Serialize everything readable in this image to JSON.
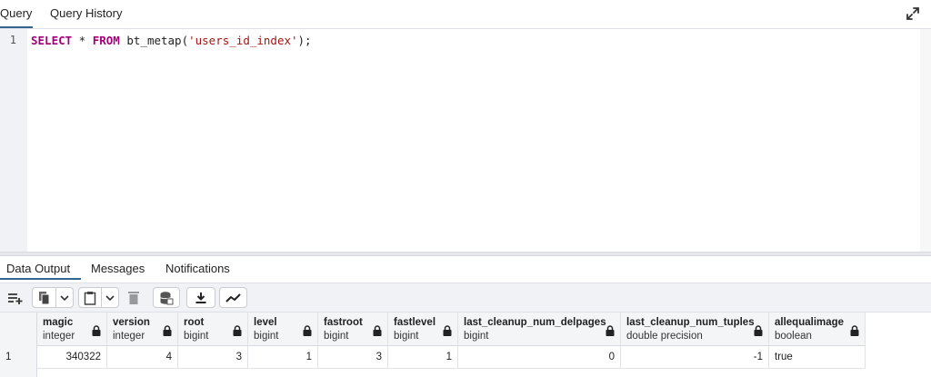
{
  "top_tabs": [
    "Query",
    "Query History"
  ],
  "editor": {
    "line_number": "1",
    "kw_select": "SELECT",
    "star": " * ",
    "kw_from": "FROM",
    "func": " bt_metap(",
    "literal": "'users_id_index'",
    "tail": ");"
  },
  "bottom_tabs": [
    "Data Output",
    "Messages",
    "Notifications"
  ],
  "toolbar": {
    "icons": [
      "add-row-icon",
      "copy-icon",
      "chevron-down-icon",
      "paste-icon",
      "chevron-down-icon",
      "delete-icon",
      "save-data-icon",
      "download-icon",
      "graph-icon"
    ]
  },
  "grid": {
    "columns": [
      {
        "name": "magic",
        "type": "integer"
      },
      {
        "name": "version",
        "type": "integer"
      },
      {
        "name": "root",
        "type": "bigint"
      },
      {
        "name": "level",
        "type": "bigint"
      },
      {
        "name": "fastroot",
        "type": "bigint"
      },
      {
        "name": "fastlevel",
        "type": "bigint"
      },
      {
        "name": "last_cleanup_num_delpages",
        "type": "bigint"
      },
      {
        "name": "last_cleanup_num_tuples",
        "type": "double precision"
      },
      {
        "name": "allequalimage",
        "type": "boolean"
      }
    ],
    "rows": [
      {
        "row_number": "1",
        "cells": [
          "340322",
          "4",
          "3",
          "1",
          "3",
          "1",
          "0",
          "-1",
          "true"
        ]
      }
    ]
  }
}
